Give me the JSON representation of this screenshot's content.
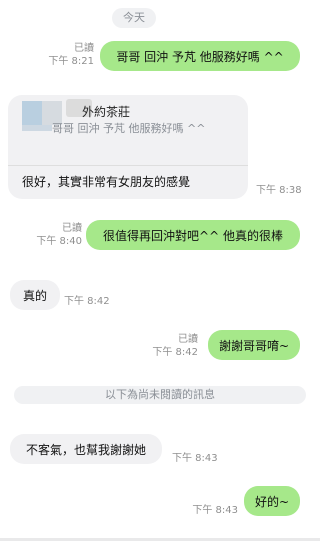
{
  "date_divider": "今天",
  "unread_divider": "以下為尚未閱讀的訊息",
  "messages": [
    {
      "text": "哥哥 回沖 予芃 他服務好嗎 ^^",
      "read": "已讀",
      "time": "下午 8:21"
    },
    {
      "reply_to_name": "外約茶莊",
      "reply_quote": "哥哥 回沖 予芃 他服務好嗎 ^^",
      "text": "很好，其實非常有女朋友的感覺",
      "time": "下午 8:38"
    },
    {
      "text": "很值得再回沖對吧^^ 他真的很棒",
      "read": "已讀",
      "time": "下午 8:40"
    },
    {
      "text": "真的",
      "time": "下午 8:42"
    },
    {
      "text": "謝謝哥哥唷~",
      "read": "已讀",
      "time": "下午 8:42"
    },
    {
      "text": "不客氣，也幫我謝謝她",
      "time": "下午 8:43"
    },
    {
      "text": "好的~",
      "time": "下午 8:43"
    }
  ],
  "colors": {
    "outgoing_bubble": "#a6e88a",
    "incoming_bubble": "#f1f1f3",
    "divider_pill": "#f0f1f3"
  }
}
